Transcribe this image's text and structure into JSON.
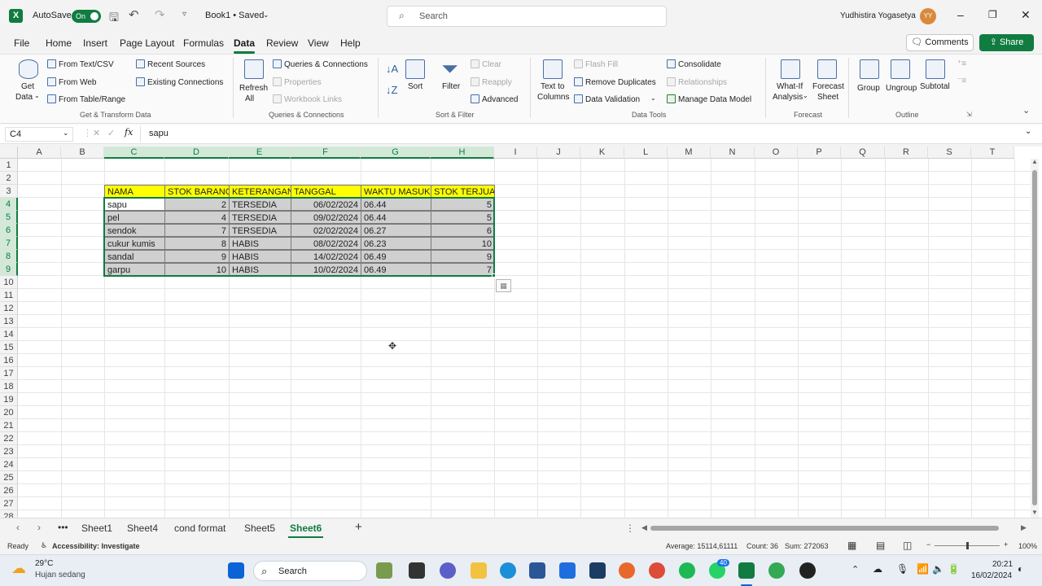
{
  "titlebar": {
    "app_letter": "X",
    "autosave_label": "AutoSave",
    "autosave_state": "On",
    "doc_title": "Book1 • Saved",
    "search_placeholder": "Search",
    "user_name": "Yudhistira Yogasetya",
    "user_initials": "YY"
  },
  "menu": {
    "items": [
      "File",
      "Home",
      "Insert",
      "Page Layout",
      "Formulas",
      "Data",
      "Review",
      "View",
      "Help"
    ],
    "active": "Data",
    "comments_label": "Comments",
    "share_label": "Share"
  },
  "ribbon": {
    "get_transform": {
      "get_data": "Get",
      "get_data2": "Data",
      "from_text_csv": "From Text/CSV",
      "from_web": "From Web",
      "from_table_range": "From Table/Range",
      "recent_sources": "Recent Sources",
      "existing_connections": "Existing Connections",
      "label": "Get & Transform Data"
    },
    "queries": {
      "refresh": "Refresh",
      "refresh2": "All",
      "queries_connections": "Queries & Connections",
      "properties": "Properties",
      "workbook_links": "Workbook Links",
      "label": "Queries & Connections"
    },
    "sort_filter": {
      "sort": "Sort",
      "filter": "Filter",
      "clear": "Clear",
      "reapply": "Reapply",
      "advanced": "Advanced",
      "label": "Sort & Filter"
    },
    "data_tools": {
      "text_to_columns": "Text to",
      "text_to_columns2": "Columns",
      "flash_fill": "Flash Fill",
      "remove_duplicates": "Remove Duplicates",
      "data_validation": "Data Validation",
      "consolidate": "Consolidate",
      "relationships": "Relationships",
      "manage_data_model": "Manage Data Model",
      "label": "Data Tools"
    },
    "forecast": {
      "what_if": "What-If",
      "what_if2": "Analysis",
      "forecast_sheet": "Forecast",
      "forecast_sheet2": "Sheet",
      "label": "Forecast"
    },
    "outline": {
      "group": "Group",
      "ungroup": "Ungroup",
      "subtotal": "Subtotal",
      "label": "Outline"
    }
  },
  "formula_bar": {
    "name_box": "C4",
    "fx": "fx",
    "value": "sapu"
  },
  "grid": {
    "columns": [
      "A",
      "B",
      "C",
      "D",
      "E",
      "F",
      "G",
      "H",
      "I",
      "J",
      "K",
      "L",
      "M",
      "N",
      "O",
      "P",
      "Q",
      "R",
      "S",
      "T"
    ],
    "rows": [
      "1",
      "2",
      "3",
      "4",
      "5",
      "6",
      "7",
      "8",
      "9",
      "10",
      "11",
      "12",
      "13",
      "14",
      "15",
      "16",
      "17",
      "18",
      "19",
      "20",
      "21",
      "22",
      "23",
      "24",
      "25",
      "26",
      "27",
      "28"
    ],
    "table": {
      "headers": [
        "NAMA",
        "STOK BARANG",
        "KETERANGAN",
        "TANGGAL",
        "WAKTU MASUK",
        "STOK TERJUAL"
      ],
      "rows": [
        [
          "sapu",
          "2",
          "TERSEDIA",
          "06/02/2024",
          "06.44",
          "5"
        ],
        [
          "pel",
          "4",
          "TERSEDIA",
          "09/02/2024",
          "06.44",
          "5"
        ],
        [
          "sendok",
          "7",
          "TERSEDIA",
          "02/02/2024",
          "06.27",
          "6"
        ],
        [
          "cukur kumis",
          "8",
          "HABIS",
          "08/02/2024",
          "06.23",
          "10"
        ],
        [
          "sandal",
          "9",
          "HABIS",
          "14/02/2024",
          "06.49",
          "9"
        ],
        [
          "garpu",
          "10",
          "HABIS",
          "10/02/2024",
          "06.49",
          "7"
        ]
      ]
    }
  },
  "tabs": {
    "items": [
      "Sheet1",
      "Sheet4",
      "cond format",
      "Sheet5",
      "Sheet6"
    ],
    "active": "Sheet6",
    "more": "•••",
    "add": "+"
  },
  "status": {
    "ready": "Ready",
    "accessibility": "Accessibility: Investigate",
    "average": "Average: 15114,61111",
    "count": "Count: 36",
    "sum": "Sum: 272063",
    "zoom": "100%"
  },
  "taskbar": {
    "temperature": "29°C",
    "weather": "Hujan sedang",
    "search_label": "Search",
    "time": "20:21",
    "date": "16/02/2024",
    "whatsapp_badge": "40"
  }
}
